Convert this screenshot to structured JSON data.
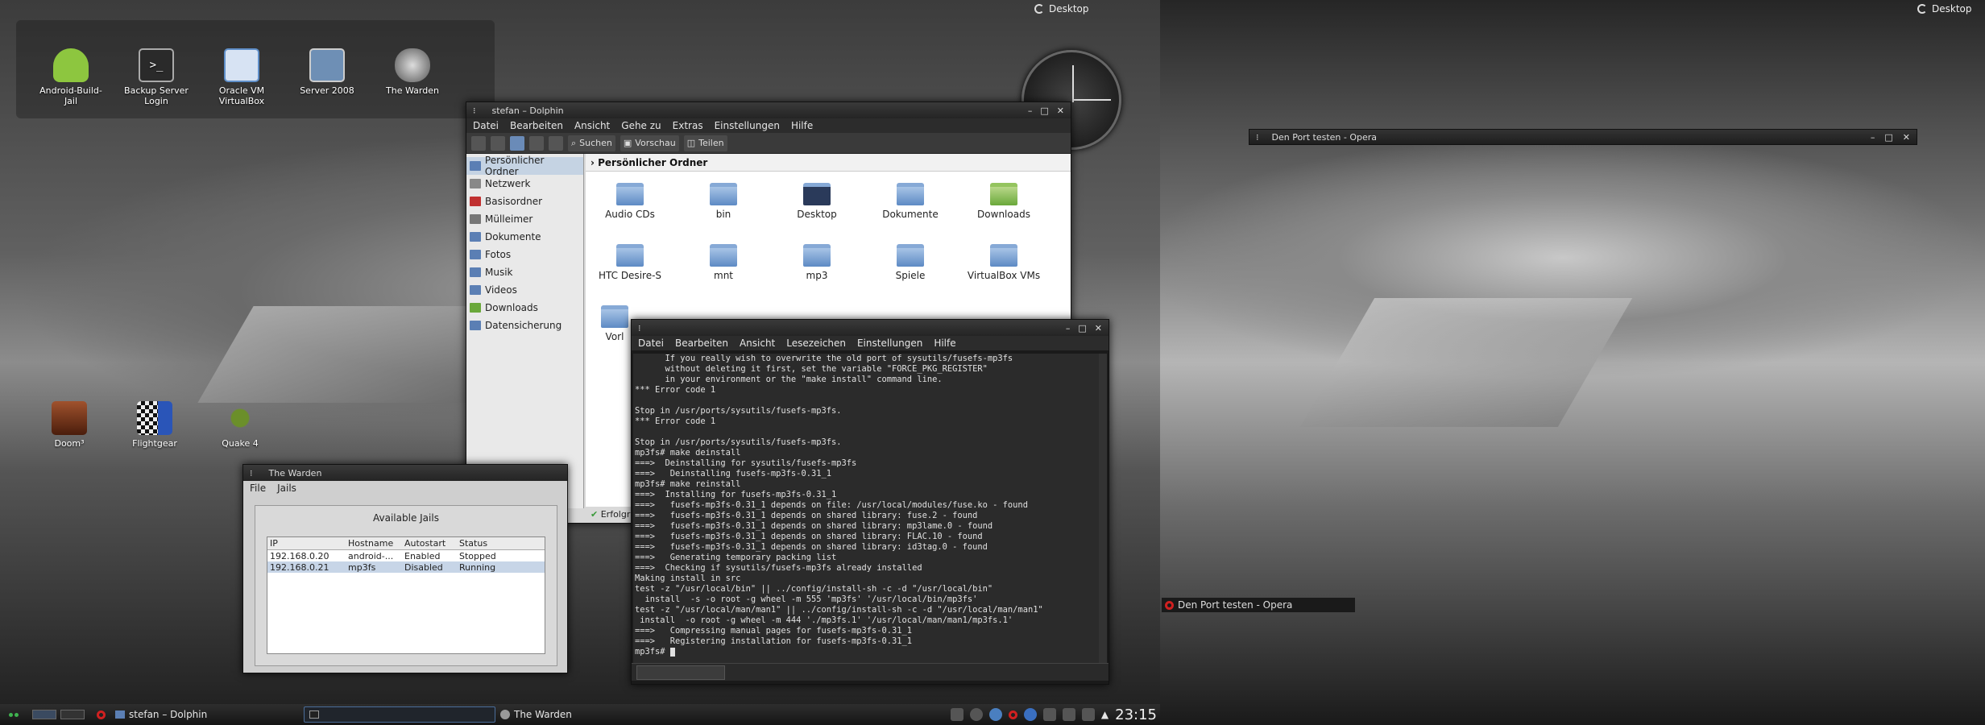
{
  "desktops": {
    "left_label": "Desktop",
    "right_label": "Desktop"
  },
  "desktop_icons": [
    {
      "label": "Android-Build-Jail",
      "icon": "android-icon",
      "color": "#8dc63f"
    },
    {
      "label": "Backup Server Login",
      "icon": "terminal-icon",
      "color": "#3a3a3a"
    },
    {
      "label": "Oracle VM VirtualBox",
      "icon": "virtualbox-icon",
      "color": "#5f8fc9"
    },
    {
      "label": "Server 2008",
      "icon": "server-icon",
      "color": "#6e8fb5"
    },
    {
      "label": "The Warden",
      "icon": "warden-icon",
      "color": "#888888"
    },
    {
      "label": "Doom³",
      "icon": "doom-icon",
      "color": "#7a3d1c"
    },
    {
      "label": "Flightgear",
      "icon": "flightgear-icon",
      "color": "#2a55b8"
    },
    {
      "label": "Quake 4",
      "icon": "quake-icon",
      "color": "#6b8f2a"
    }
  ],
  "dolphin": {
    "title": "stefan – Dolphin",
    "menu": [
      "Datei",
      "Bearbeiten",
      "Ansicht",
      "Gehe zu",
      "Extras",
      "Einstellungen",
      "Hilfe"
    ],
    "toolbar": {
      "search": "Suchen",
      "preview": "Vorschau",
      "split": "Teilen"
    },
    "places": [
      "Persönlicher Ordner",
      "Netzwerk",
      "Basisordner",
      "Mülleimer",
      "Dokumente",
      "Fotos",
      "Musik",
      "Videos",
      "Downloads",
      "Datensicherung"
    ],
    "breadcrumb": "Persönlicher Ordner",
    "files": [
      "Audio CDs",
      "bin",
      "Desktop",
      "Dokumente",
      "Downloads",
      "HTC Desire-S",
      "mnt",
      "mp3",
      "Spiele",
      "VirtualBox VMs",
      "Vorl"
    ],
    "status": "Erfolgr"
  },
  "terminal": {
    "menu": [
      "Datei",
      "Bearbeiten",
      "Ansicht",
      "Lesezeichen",
      "Einstellungen",
      "Hilfe"
    ],
    "lines": [
      "      If you really wish to overwrite the old port of sysutils/fusefs-mp3fs",
      "      without deleting it first, set the variable \"FORCE_PKG_REGISTER\"",
      "      in your environment or the \"make install\" command line.",
      "*** Error code 1",
      "",
      "Stop in /usr/ports/sysutils/fusefs-mp3fs.",
      "*** Error code 1",
      "",
      "Stop in /usr/ports/sysutils/fusefs-mp3fs.",
      "mp3fs# make deinstall",
      "===>  Deinstalling for sysutils/fusefs-mp3fs",
      "===>   Deinstalling fusefs-mp3fs-0.31_1",
      "mp3fs# make reinstall",
      "===>  Installing for fusefs-mp3fs-0.31_1",
      "===>   fusefs-mp3fs-0.31_1 depends on file: /usr/local/modules/fuse.ko - found",
      "===>   fusefs-mp3fs-0.31_1 depends on shared library: fuse.2 - found",
      "===>   fusefs-mp3fs-0.31_1 depends on shared library: mp3lame.0 - found",
      "===>   fusefs-mp3fs-0.31_1 depends on shared library: FLAC.10 - found",
      "===>   fusefs-mp3fs-0.31_1 depends on shared library: id3tag.0 - found",
      "===>   Generating temporary packing list",
      "===>  Checking if sysutils/fusefs-mp3fs already installed",
      "Making install in src",
      "test -z \"/usr/local/bin\" || ../config/install-sh -c -d \"/usr/local/bin\"",
      "  install  -s -o root -g wheel -m 555 'mp3fs' '/usr/local/bin/mp3fs'",
      "test -z \"/usr/local/man/man1\" || ../config/install-sh -c -d \"/usr/local/man/man1\"",
      " install  -o root -g wheel -m 444 './mp3fs.1' '/usr/local/man/man1/mp3fs.1'",
      "===>   Compressing manual pages for fusefs-mp3fs-0.31_1",
      "===>   Registering installation for fusefs-mp3fs-0.31_1",
      "mp3fs# "
    ]
  },
  "warden": {
    "title": "The Warden",
    "menu": [
      "File",
      "Jails"
    ],
    "heading": "Available Jails",
    "columns": [
      "IP",
      "Hostname",
      "Autostart",
      "Status"
    ],
    "rows": [
      [
        "192.168.0.20",
        "android-...",
        "Enabled",
        "Stopped"
      ],
      [
        "192.168.0.21",
        "mp3fs",
        "Disabled",
        "Running"
      ]
    ]
  },
  "opera": {
    "title": "Den Port testen - Opera",
    "task_label": "Den Port testen - Opera"
  },
  "taskbar": {
    "tasks": [
      "stefan – Dolphin",
      "",
      "The Warden"
    ],
    "clock": "23:15"
  }
}
